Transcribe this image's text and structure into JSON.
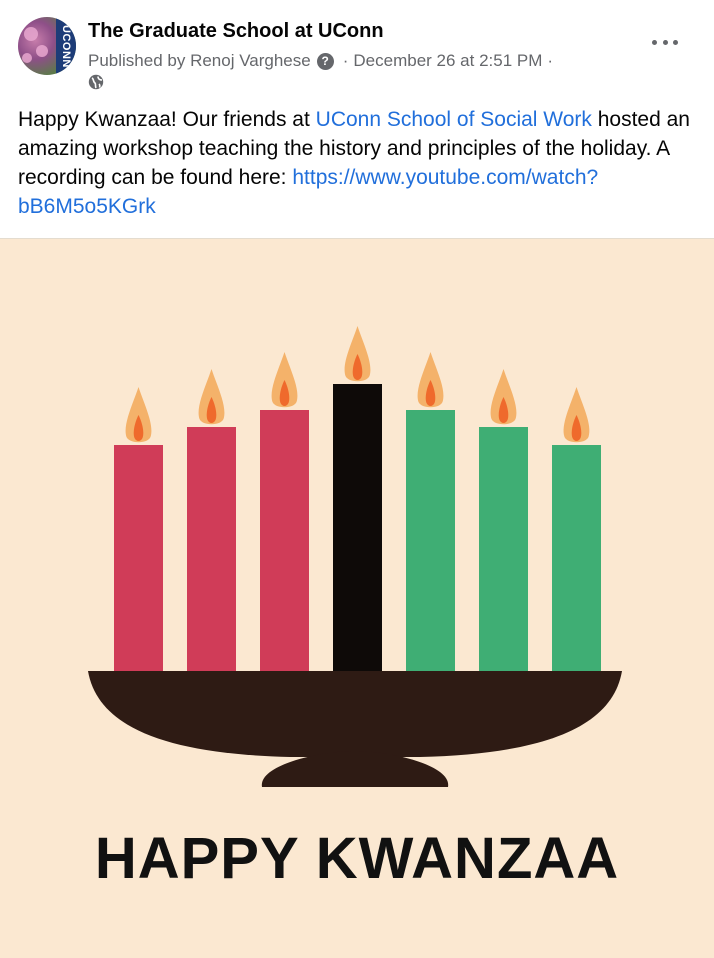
{
  "post": {
    "page_name": "The Graduate School at UConn",
    "published_prefix": "Published by Renoj Varghese",
    "help_glyph": "?",
    "separator": "·",
    "date": "December 26 at 2:51 PM",
    "avatar_text": "UCONN",
    "text_intro": "Happy Kwanzaa! Our friends at ",
    "text_mention": "UConn School of Social Work",
    "text_rest": " hosted an amazing workshop teaching the history and principles of the holiday. A recording can be found here: ",
    "text_link": "https://www.youtube.com/watch?bB6M5o5KGrk"
  },
  "image": {
    "greeting": "HAPPY KWANZAA",
    "candle_colors": [
      "#d03c58",
      "#d03c58",
      "#d03c58",
      "#0e0a08",
      "#3fae74",
      "#3fae74",
      "#3fae74"
    ],
    "holder_color": "#2e1b14",
    "background": "#fbe8d1"
  },
  "icons": [
    "help-icon",
    "globe-icon",
    "more-icon"
  ]
}
